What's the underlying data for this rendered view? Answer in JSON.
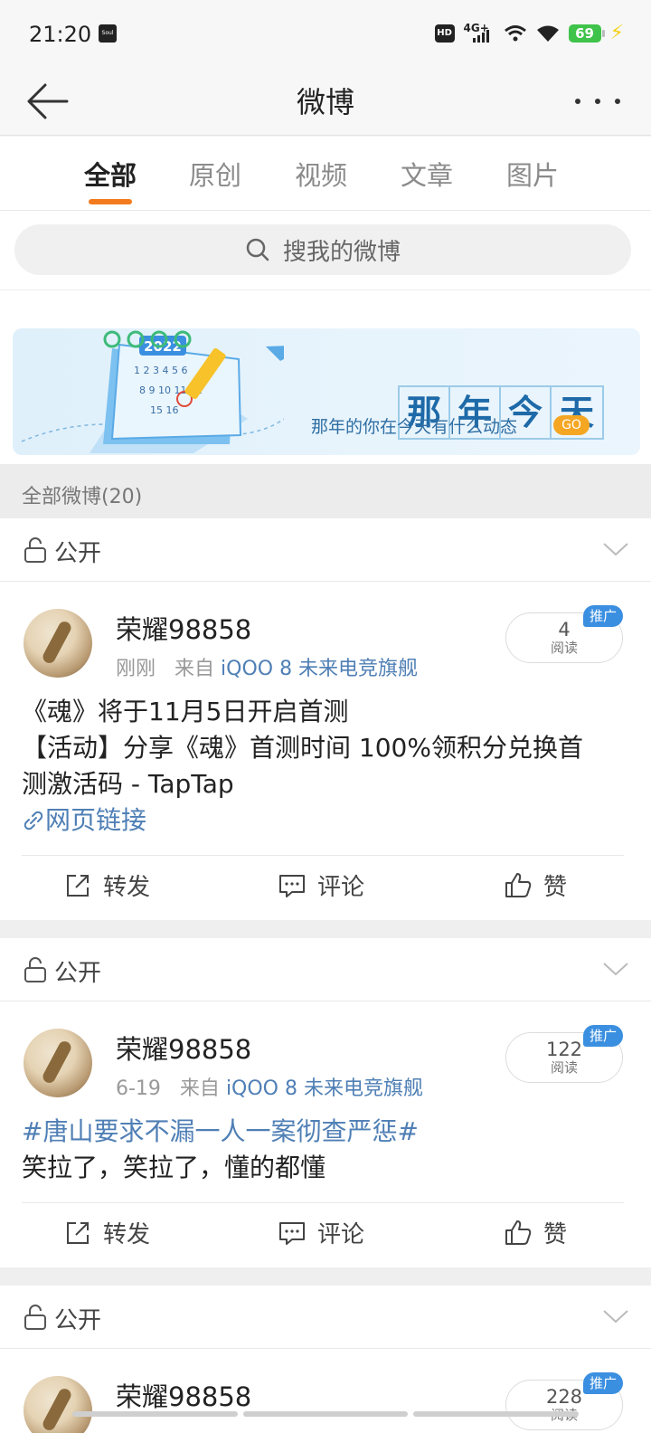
{
  "status": {
    "time": "21:20",
    "app_badge": "Soul",
    "hd": "HD",
    "network": "4G+",
    "battery": "69"
  },
  "header": {
    "title": "微博"
  },
  "tabs": [
    {
      "label": "全部",
      "active": true
    },
    {
      "label": "原创",
      "active": false
    },
    {
      "label": "视频",
      "active": false
    },
    {
      "label": "文章",
      "active": false
    },
    {
      "label": "图片",
      "active": false
    }
  ],
  "search": {
    "placeholder": "搜我的微博"
  },
  "banner": {
    "calendar_year": "2022",
    "title_chars": [
      "那",
      "年",
      "今",
      "天"
    ],
    "subtitle": "那年的你在今天有什么动态",
    "go": "GO"
  },
  "section": {
    "label": "全部微博(20)"
  },
  "posts": [
    {
      "privacy": "公开",
      "user": "荣耀98858",
      "time": "刚刚",
      "from_label": "来自",
      "source": "iQOO 8 未来电竞旗舰",
      "reads": "4",
      "reads_label": "阅读",
      "promo": "推广",
      "lines": [
        "《魂》将于11月5日开启首测",
        "【活动】分享《魂》首测时间 100%领积分兑换首",
        "测激活码 - TapTap"
      ],
      "link": "网页链接",
      "actions": {
        "repost": "转发",
        "comment": "评论",
        "like": "赞"
      }
    },
    {
      "privacy": "公开",
      "user": "荣耀98858",
      "time": "6-19",
      "from_label": "来自",
      "source": "iQOO 8 未来电竞旗舰",
      "reads": "122",
      "reads_label": "阅读",
      "promo": "推广",
      "hashtag": "#唐山要求不漏一人一案彻查严惩#",
      "text": "笑拉了，笑拉了，懂的都懂",
      "actions": {
        "repost": "转发",
        "comment": "评论",
        "like": "赞"
      }
    },
    {
      "privacy": "公开",
      "user": "荣耀98858",
      "reads": "228",
      "reads_label": "阅读",
      "promo": "推广"
    }
  ],
  "colors": {
    "accent": "#f37b1d",
    "link": "#4f7fb5",
    "promo": "#3b8fe0"
  }
}
